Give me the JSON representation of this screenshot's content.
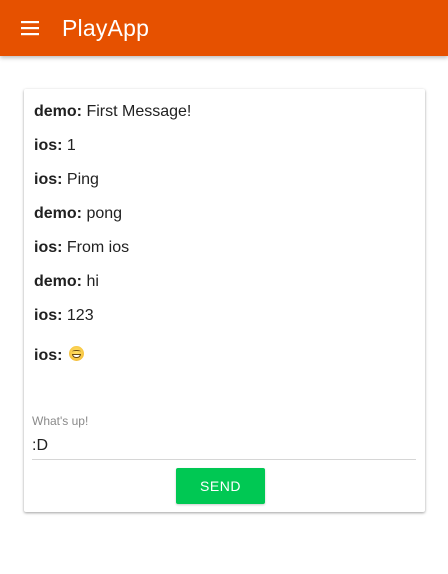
{
  "appbar": {
    "title": "PlayApp",
    "menu_icon": "menu-icon",
    "color": "#e65100"
  },
  "messages": [
    {
      "user": "demo:",
      "text": "First Message!"
    },
    {
      "user": "ios:",
      "text": "1"
    },
    {
      "user": "ios:",
      "text": "Ping"
    },
    {
      "user": "demo:",
      "text": "pong"
    },
    {
      "user": "ios:",
      "text": "From ios"
    },
    {
      "user": "demo:",
      "text": "hi"
    },
    {
      "user": "ios:",
      "text": "123"
    },
    {
      "user": "ios:",
      "text": "",
      "emoji": "grinning-face-emoji"
    }
  ],
  "compose": {
    "label": "What's up!",
    "value": ":D",
    "send_label": "SEND",
    "send_color": "#00c853"
  }
}
